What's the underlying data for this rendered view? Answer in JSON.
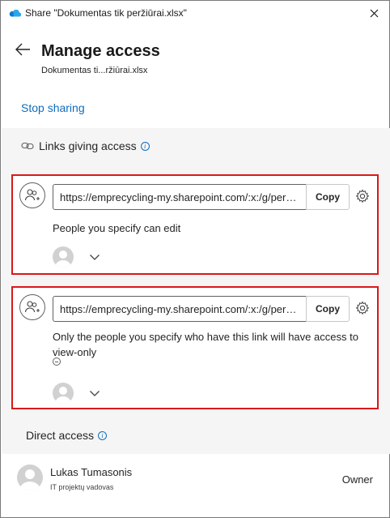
{
  "window": {
    "title": "Share \"Dokumentas tik peržiūrai.xlsx\""
  },
  "header": {
    "heading": "Manage access",
    "filename": "Dokumentas ti...ržiūrai.xlsx"
  },
  "actions": {
    "stop_sharing": "Stop sharing"
  },
  "links_section": {
    "label": "Links giving access",
    "links": [
      {
        "url": "https://emprecycling-my.sharepoint.com/:x:/g/personal",
        "copy_label": "Copy",
        "description": "People you specify can edit"
      },
      {
        "url": "https://emprecycling-my.sharepoint.com/:x:/g/personal",
        "copy_label": "Copy",
        "description": "Only the people you specify who have this link will have access to view-only"
      }
    ]
  },
  "direct_section": {
    "label": "Direct access",
    "users": [
      {
        "name": "Lukas Tumasonis",
        "title": "IT projektų vadovas",
        "role": "Owner"
      }
    ]
  },
  "colors": {
    "accent": "#0f6cbd",
    "highlight_border": "#d9191a",
    "section_bg": "#f5f5f5"
  },
  "icons": [
    "onedrive-cloud-icon",
    "close-icon",
    "back-arrow-icon",
    "link-icon",
    "info-icon",
    "people-add-icon",
    "gear-icon",
    "person-icon",
    "chevron-down-icon",
    "minus-circle-icon"
  ]
}
